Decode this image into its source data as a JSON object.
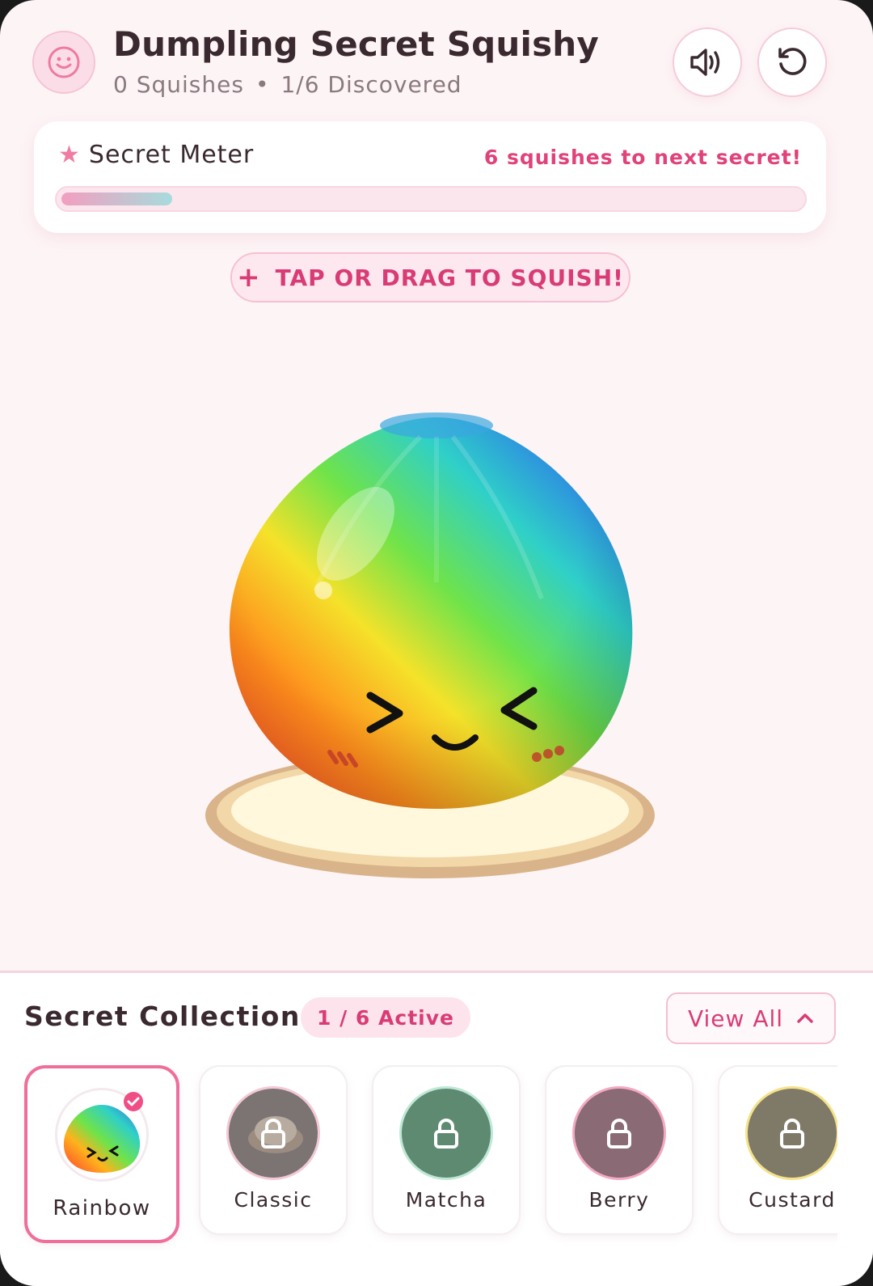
{
  "app": {
    "title": "Dumpling Secret Squishy",
    "squish_count": "0 Squishes",
    "separator": "•",
    "discovered": "1/6 Discovered"
  },
  "header_buttons": [
    {
      "name": "sound",
      "icon": "speaker-icon"
    },
    {
      "name": "reset",
      "icon": "refresh-icon"
    }
  ],
  "meter": {
    "title": "Secret Meter",
    "next_text": "6 squishes to next secret!",
    "progress": 0.15
  },
  "hint": {
    "plus": "+",
    "text": "TAP OR DRAG TO SQUISH!"
  },
  "collection": {
    "title": "Secret Collection",
    "active_badge": "1 / 6 Active",
    "view_all": "View All",
    "items": [
      {
        "label": "Rainbow",
        "state": "unlocked",
        "selected": true,
        "ring": "#ffffff"
      },
      {
        "label": "Classic",
        "state": "locked",
        "ring": "#f3c9d6"
      },
      {
        "label": "Matcha",
        "state": "locked",
        "ring": "#bfe8d6"
      },
      {
        "label": "Berry",
        "state": "locked",
        "ring": "#f3a9c3"
      },
      {
        "label": "Custard",
        "state": "locked",
        "ring": "#f5e28a"
      }
    ]
  },
  "colors": {
    "accent": "#e0427a",
    "background": "#fdf4f6"
  }
}
